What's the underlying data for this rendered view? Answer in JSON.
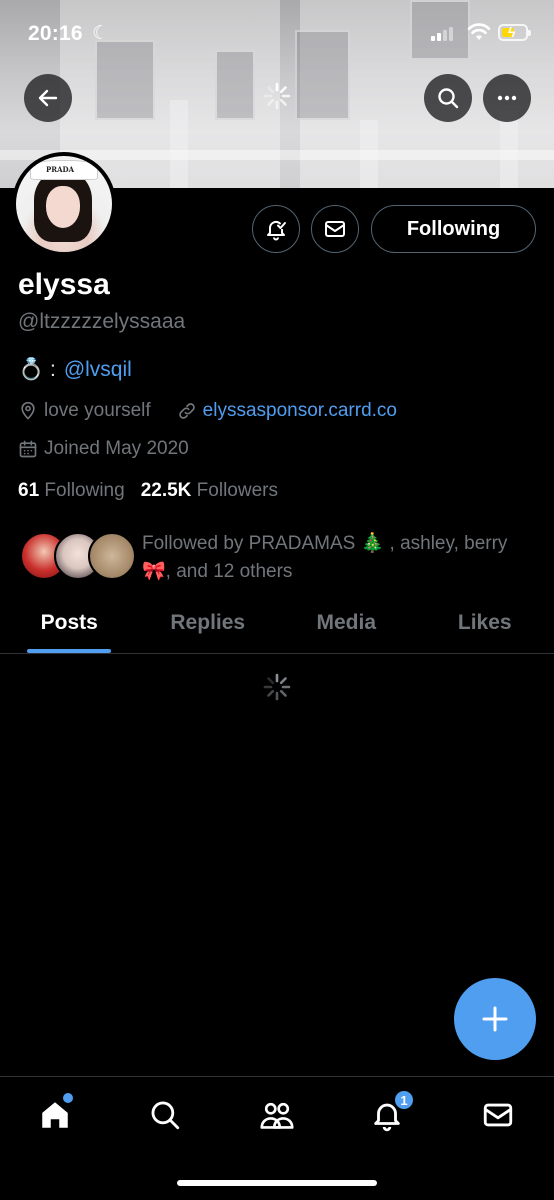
{
  "status_bar": {
    "time": "20:16"
  },
  "profile": {
    "display_name": "elyssa",
    "handle": "@ltzzzzzelyssaaa",
    "bio_prefix": "💍 :",
    "bio_link": "@lvsqil",
    "location": "love yourself",
    "website": "elyssasponsor.carrd.co",
    "joined": "Joined May 2020",
    "following_count": "61",
    "following_label": "Following",
    "followers_count": "22.5K",
    "followers_label": "Followers",
    "followed_by": "Followed by PRADAMAS 🎄 , ashley, berry 🎀, and 12 others",
    "avatar_hat_text": "PRADA"
  },
  "actions": {
    "following_button": "Following"
  },
  "tabs": [
    {
      "label": "Posts",
      "active": true
    },
    {
      "label": "Replies",
      "active": false
    },
    {
      "label": "Media",
      "active": false
    },
    {
      "label": "Likes",
      "active": false
    }
  ],
  "bottom_nav": {
    "items": [
      "home-icon",
      "search-icon",
      "communities-icon",
      "notifications-icon",
      "messages-icon"
    ],
    "notifications_badge": "1"
  },
  "colors": {
    "accent": "#4f9ef0",
    "background": "#000000",
    "muted": "#71767b"
  }
}
